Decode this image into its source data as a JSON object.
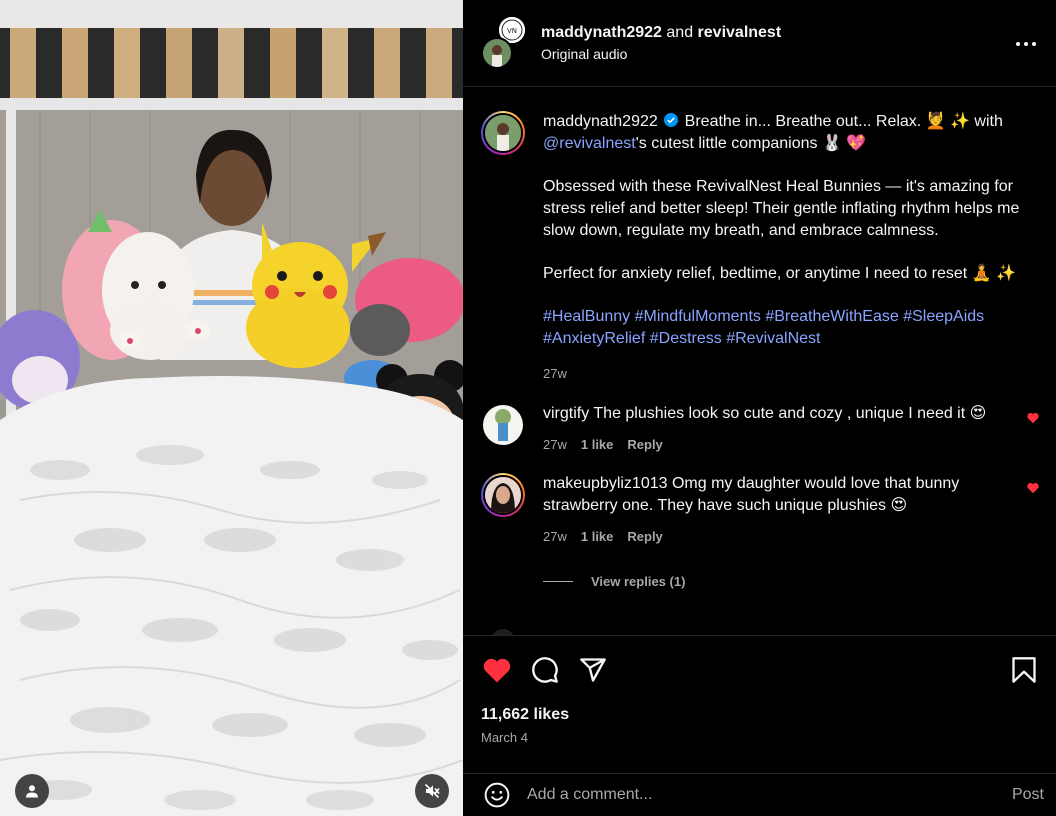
{
  "header": {
    "author": "maddynath2922",
    "joiner": "and",
    "collaborator": "revivalnest",
    "audio": "Original audio",
    "collab_badge_text": "VN"
  },
  "caption": {
    "username": "maddynath2922",
    "line1": "Breathe in... Breathe out... Relax. 💆 ✨ with",
    "mention": "@revivalnest",
    "line1_tail": "'s cutest little companions 🐰 💖",
    "para2": "Obsessed with these RevivalNest Heal Bunnies — it's amazing for stress relief and better sleep! Their gentle inflating rhythm helps me slow down, regulate my breath, and embrace calmness.",
    "para3": "Perfect for anxiety relief, bedtime, or anytime I need to reset 🧘 ✨",
    "hashtags": [
      "#HealBunny",
      "#MindfulMoments",
      "#BreatheWithEase",
      "#SleepAids",
      "#AnxietyRelief",
      "#Destress",
      "#RevivalNest"
    ],
    "time": "27w"
  },
  "comments": [
    {
      "username": "virgtify",
      "text": "The plushies look so cute and cozy , unique I need it 😍",
      "time": "27w",
      "likes": "1 like",
      "reply": "Reply"
    },
    {
      "username": "makeupbyliz1013",
      "text": "Omg my daughter would love that bunny strawberry one. They have such unique plushies 😍",
      "time": "27w",
      "likes": "1 like",
      "reply": "Reply"
    }
  ],
  "view_replies": "View replies (1)",
  "likes_count": "11,662 likes",
  "post_date": "March 4",
  "add_comment": {
    "placeholder": "Add a comment...",
    "post_label": "Post"
  },
  "colors": {
    "background": "#000000",
    "text": "#f5f5f5",
    "muted": "#a8a8a8",
    "link": "#8aa4ff",
    "like_red": "#ff3040",
    "verified_blue": "#0095f6"
  },
  "icons": [
    "user-tag-icon",
    "muted-audio-icon",
    "more-options-icon",
    "verified-badge-icon",
    "heart-icon",
    "comment-icon",
    "share-icon",
    "bookmark-icon",
    "emoji-icon"
  ]
}
